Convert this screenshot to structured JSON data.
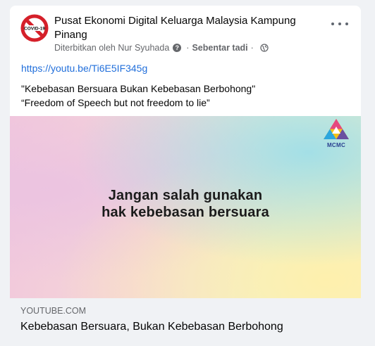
{
  "post": {
    "page_name": "Pusat Ekonomi Digital Keluarga Malaysia Kampung Pinang",
    "avatar_label": "COVID-19",
    "published_by": "Diterbitkan oleh Nur Syuhada",
    "time": "Sebentar tadi",
    "privacy_icon": "globe-icon",
    "link": "https://youtu.be/Ti6E5IF345g",
    "text_line_1": "\"Kebebasan Bersuara Bukan Kebebasan Berbohong\"",
    "text_line_2": "“Freedom of Speech but not freedom to lie”"
  },
  "media": {
    "caption_line_1": "Jangan salah gunakan",
    "caption_line_2": "hak kebebasan bersuara",
    "logo_text": "MCMC"
  },
  "preview": {
    "domain": "YOUTUBE.COM",
    "title": "Kebebasan Bersuara, Bukan Kebebasan Berbohong"
  },
  "colors": {
    "link": "#216fdb",
    "avatar_red": "#d5202a",
    "text": "#050505",
    "secondary": "#65676b"
  }
}
